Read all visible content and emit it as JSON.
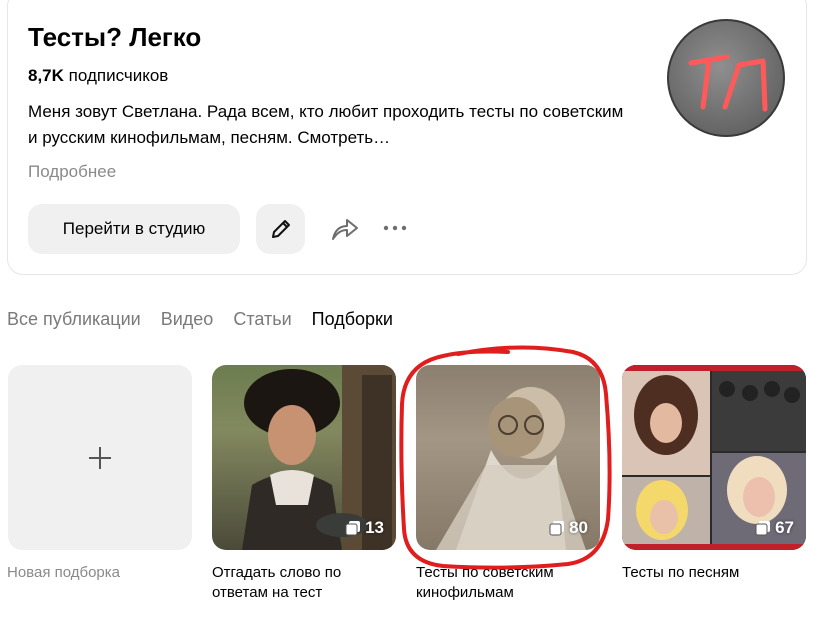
{
  "channel": {
    "title": "Тесты? Легко",
    "subscribers_count": "8,7K",
    "subscribers_label": "подписчиков",
    "description": "Меня зовут Светлана. Рада всем, кто любит проходить тесты по советским и русским кинофильмам, песням. Смотреть…",
    "more_label": "Подробнее",
    "avatar_text": "ТЛ",
    "avatar_letter_color": "#ff4b4b"
  },
  "actions": {
    "studio_button": "Перейти в студию",
    "edit_icon": "pencil-icon",
    "share_icon": "share-icon",
    "more_icon": "more-dots-icon"
  },
  "tabs": [
    {
      "label": "Все публикации",
      "active": false
    },
    {
      "label": "Видео",
      "active": false
    },
    {
      "label": "Статьи",
      "active": false
    },
    {
      "label": "Подборки",
      "active": true
    }
  ],
  "collections": {
    "new": {
      "label": "Новая подборка",
      "icon": "plus-icon"
    },
    "items": [
      {
        "title": "Отгадать слово по ответам на тест",
        "count": "13"
      },
      {
        "title": "Тесты по советским кинофильмам",
        "count": "80"
      },
      {
        "title": "Тесты по песням",
        "count": "67"
      }
    ]
  },
  "colors": {
    "accent_annotation": "#e01e1e",
    "muted_text": "#8a8a8a",
    "button_bg": "#f0f0f0"
  }
}
